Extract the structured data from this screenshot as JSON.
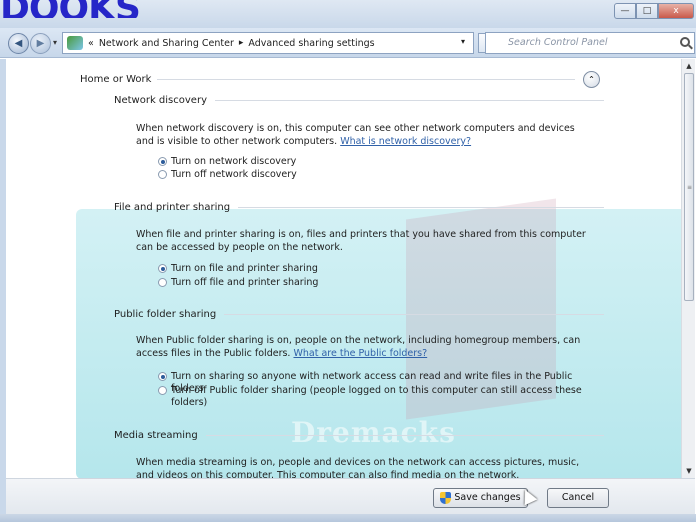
{
  "watermark": {
    "logo": "DOOKS",
    "overlay": "Dremacks"
  },
  "window": {
    "controls": {
      "minimize": "—",
      "maximize": "□",
      "close": "x"
    }
  },
  "navbar": {
    "back": "◀",
    "forward": "▶",
    "dropdown": "▾",
    "breadcrumb": {
      "prefix": "«",
      "parent": "Network and Sharing Center",
      "separator": "▸",
      "current": "Advanced sharing settings"
    },
    "address_dropdown": "▾",
    "refresh": "↻",
    "search_placeholder": "Search Control Panel"
  },
  "group": {
    "title": "Home or Work",
    "collapse": "⌃"
  },
  "sections": [
    {
      "title": "Network discovery",
      "desc": "When network discovery is on, this computer can see other network computers and devices and is visible to other network computers.",
      "link": "What is network discovery?",
      "options": [
        {
          "label": "Turn on network discovery",
          "selected": true
        },
        {
          "label": "Turn off network discovery",
          "selected": false
        }
      ]
    },
    {
      "title": "File and printer sharing",
      "desc": "When file and printer sharing is on, files and printers that you have shared from this computer can be accessed by people on the network.",
      "link": "",
      "options": [
        {
          "label": "Turn on file and printer sharing",
          "selected": true
        },
        {
          "label": "Turn off file and printer sharing",
          "selected": false
        }
      ]
    },
    {
      "title": "Public folder sharing",
      "desc": "When Public folder sharing is on, people on the network, including homegroup members, can access files in the Public folders.",
      "link": "What are the Public folders?",
      "options": [
        {
          "label": "Turn on sharing so anyone with network access can read and write files in the Public folders",
          "selected": true
        },
        {
          "label": "Turn off Public folder sharing (people logged on to this computer can still access these folders)",
          "selected": false
        }
      ]
    },
    {
      "title": "Media streaming",
      "desc": "When media streaming is on, people and devices on the network can access pictures, music, and videos on this computer. This computer can also find media on the network.",
      "link": "",
      "options": []
    }
  ],
  "footer": {
    "save": "Save changes",
    "cancel": "Cancel"
  },
  "scrollbar": {
    "up": "▲",
    "down": "▼",
    "grip": "≡",
    "position": 0.0
  },
  "colors": {
    "link": "#3061a8",
    "accent": "#2d5c9a"
  }
}
